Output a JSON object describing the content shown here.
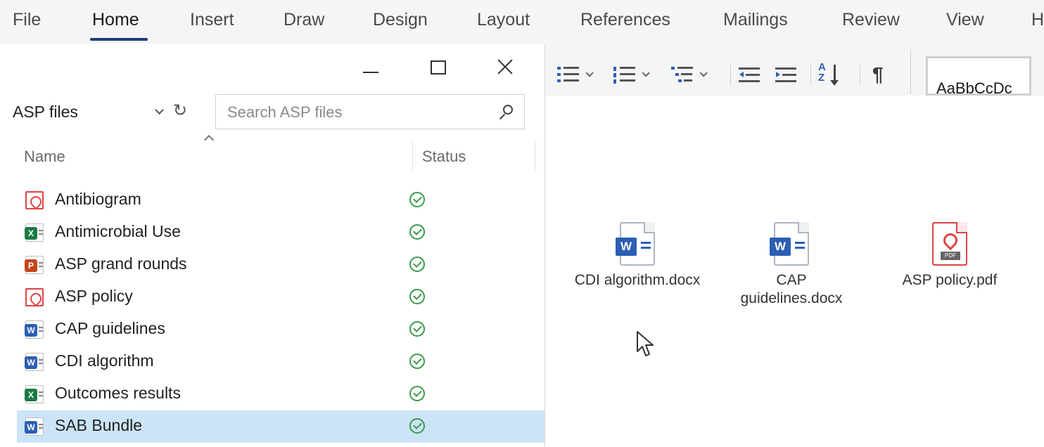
{
  "ribbon": {
    "tabs": [
      "File",
      "Home",
      "Insert",
      "Draw",
      "Design",
      "Layout",
      "References",
      "Mailings",
      "Review",
      "View",
      "H"
    ],
    "active_tab": "Home",
    "styles_preview": "AaBbCcDc"
  },
  "explorer": {
    "location": "ASP files",
    "search_placeholder": "Search ASP files",
    "columns": {
      "name": "Name",
      "status": "Status"
    },
    "files": [
      {
        "name": "Antibiogram",
        "type": "pdf"
      },
      {
        "name": "Antimicrobial Use",
        "type": "excel"
      },
      {
        "name": "ASP grand rounds",
        "type": "powerpoint"
      },
      {
        "name": "ASP policy",
        "type": "pdf"
      },
      {
        "name": "CAP guidelines",
        "type": "word"
      },
      {
        "name": "CDI algorithm",
        "type": "word"
      },
      {
        "name": "Outcomes results",
        "type": "excel"
      },
      {
        "name": "SAB Bundle",
        "type": "word",
        "selected": true
      }
    ]
  },
  "desktop": {
    "files": [
      {
        "label": "CDI algorithm.docx",
        "type": "word"
      },
      {
        "label": "CAP\nguidelines.docx",
        "type": "word"
      },
      {
        "label": "ASP policy.pdf",
        "type": "pdf"
      }
    ]
  },
  "colors": {
    "accent": "#1f3d7a",
    "selection": "#cce4f7",
    "status_ok": "#3b9a4b",
    "word": "#2b5fb4",
    "excel": "#1d7a44",
    "powerpoint": "#c4451d",
    "pdf": "#dd4444"
  }
}
